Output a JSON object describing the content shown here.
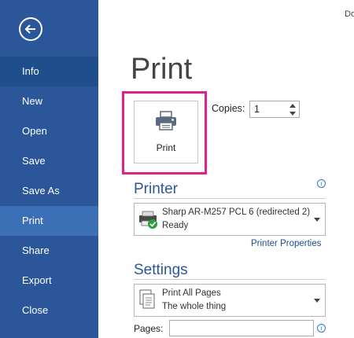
{
  "window": {
    "doc_title": "Do"
  },
  "sidebar": {
    "back_icon": "back-arrow-icon",
    "items": [
      {
        "label": "Info"
      },
      {
        "label": "New"
      },
      {
        "label": "Open"
      },
      {
        "label": "Save"
      },
      {
        "label": "Save As"
      },
      {
        "label": "Print"
      },
      {
        "label": "Share"
      },
      {
        "label": "Export"
      },
      {
        "label": "Close"
      }
    ],
    "colors": {
      "background": "#2b579a",
      "selected": "#3d6fb6"
    }
  },
  "main": {
    "title": "Print",
    "print_button": {
      "label": "Print",
      "icon": "printer-icon"
    },
    "copies": {
      "label": "Copies:",
      "value": "1"
    },
    "printer": {
      "section_title": "Printer",
      "name": "Sharp AR-M257 PCL 6 (redirected 2)",
      "status": "Ready",
      "properties_link": "Printer Properties"
    },
    "settings": {
      "section_title": "Settings",
      "option_title": "Print All Pages",
      "option_desc": "The whole thing",
      "pages_label": "Pages:",
      "pages_value": ""
    },
    "highlight_color": "#e0218a"
  }
}
